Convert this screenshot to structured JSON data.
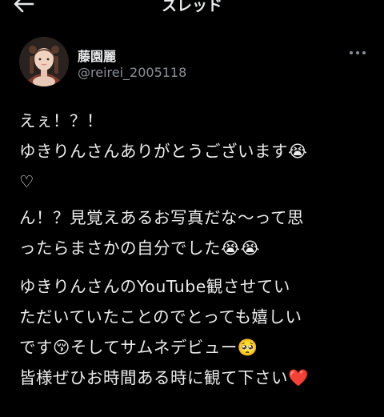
{
  "header": {
    "title": "スレッド",
    "back_icon": "arrow-left-icon",
    "more_icon": "more-dots-icon"
  },
  "author": {
    "display_name": "藤園麗",
    "handle": "@reirei_2005118"
  },
  "tweet": {
    "paragraphs": [
      "えぇ！？！\nゆきりんさんありがとうございます😭\n♡",
      "ん！？見覚えあるお写真だな〜って思\nったらまさかの自分でした😭😭",
      "ゆきりんさんのYouTube観させてい\nただいていたことのでとっても嬉しい\nです😚そしてサムネデビュー🥺\n皆様ぜひお時間ある時に観て下さい❤️"
    ]
  },
  "colors": {
    "background": "#000000",
    "text": "#e7e9ea",
    "secondary_text": "#8b9096"
  }
}
